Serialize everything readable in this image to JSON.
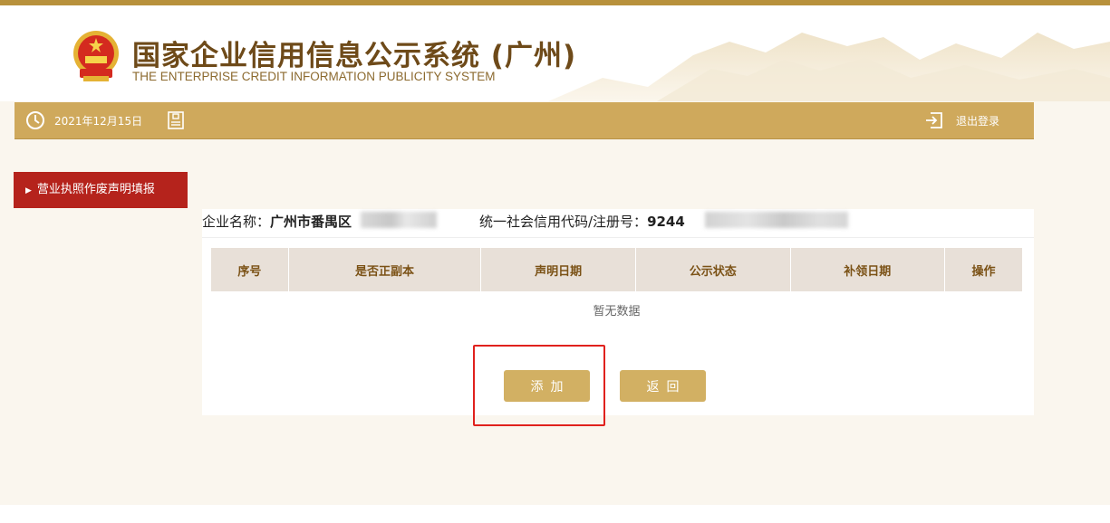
{
  "header": {
    "title_cn": "国家企业信用信息公示系统 (广州)",
    "title_en": "THE ENTERPRISE CREDIT INFORMATION PUBLICITY SYSTEM"
  },
  "navbar": {
    "date": "2021年12月15日",
    "logout_label": "退出登录"
  },
  "sidebar": {
    "items": [
      {
        "label": "营业执照作废声明填报",
        "active": true
      }
    ]
  },
  "company": {
    "name_label": "企业名称：",
    "name_value": "广州市番禺区",
    "code_label": "统一社会信用代码/注册号：",
    "code_value": "9244"
  },
  "table": {
    "columns": [
      "序号",
      "是否正副本",
      "声明日期",
      "公示状态",
      "补领日期",
      "操作"
    ],
    "empty_text": "暂无数据"
  },
  "actions": {
    "add_label": "添加",
    "back_label": "返回"
  },
  "colors": {
    "brand_gold": "#cfa95c",
    "menu_red": "#b5231c",
    "title_brown": "#6e4a19",
    "highlight_red": "#e0211d"
  }
}
